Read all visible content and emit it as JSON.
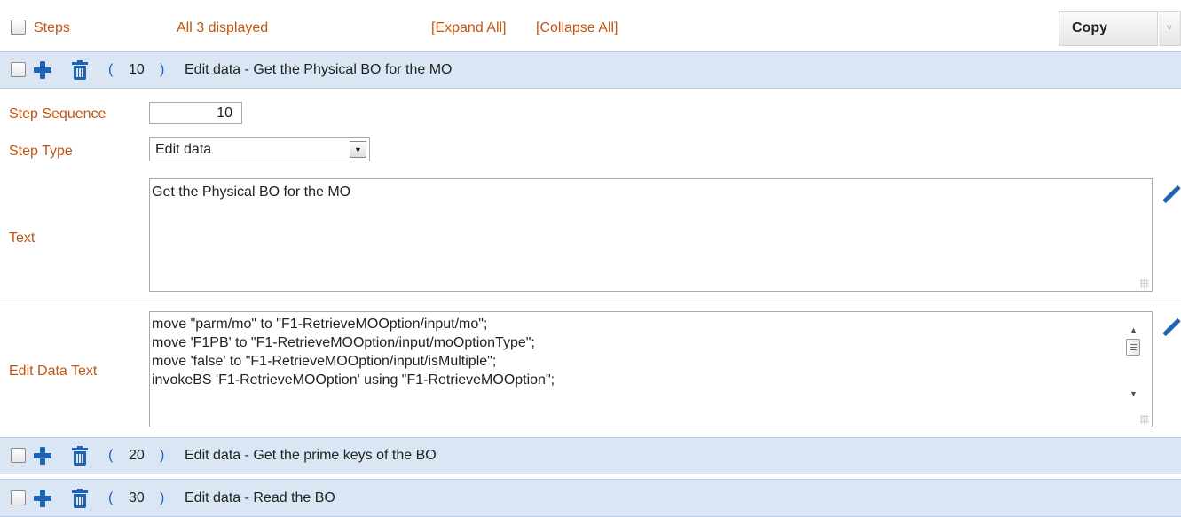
{
  "header": {
    "steps_label": "Steps",
    "displayed_label": "All 3 displayed",
    "expand_all": "[Expand All]",
    "collapse_all": "[Collapse All]",
    "copy_label": "Copy",
    "copy_arrow": "˅"
  },
  "steps": [
    {
      "open_paren": "(",
      "seq": "10",
      "close_paren": ")",
      "title": "Edit data - Get the Physical BO for the MO"
    },
    {
      "open_paren": "(",
      "seq": "20",
      "close_paren": ")",
      "title": "Edit data - Get the prime keys of the BO"
    },
    {
      "open_paren": "(",
      "seq": "30",
      "close_paren": ")",
      "title": "Edit data - Read the BO"
    }
  ],
  "detail": {
    "seq_label": "Step Sequence",
    "seq_value": "10",
    "type_label": "Step Type",
    "type_value": "Edit data",
    "text_label": "Text",
    "text_value": "Get the Physical BO for the MO",
    "edit_label": "Edit Data Text",
    "edit_lines": [
      "move \"parm/mo\" to \"F1-RetrieveMOOption/input/mo\";",
      "move 'F1PB' to \"F1-RetrieveMOOption/input/moOptionType\";",
      "move 'false' to \"F1-RetrieveMOOption/input/isMultiple\";",
      "invokeBS 'F1-RetrieveMOOption' using \"F1-RetrieveMOOption\";"
    ]
  },
  "colors": {
    "label_orange": "#c4550f",
    "icon_blue": "#1f63b4",
    "bar_blue": "#dbe6f4"
  },
  "icons": [
    "checkbox",
    "plus-icon",
    "trash-icon",
    "pencil-icon",
    "dropdown-arrow-icon",
    "scroll-up-icon",
    "scroll-down-icon"
  ]
}
